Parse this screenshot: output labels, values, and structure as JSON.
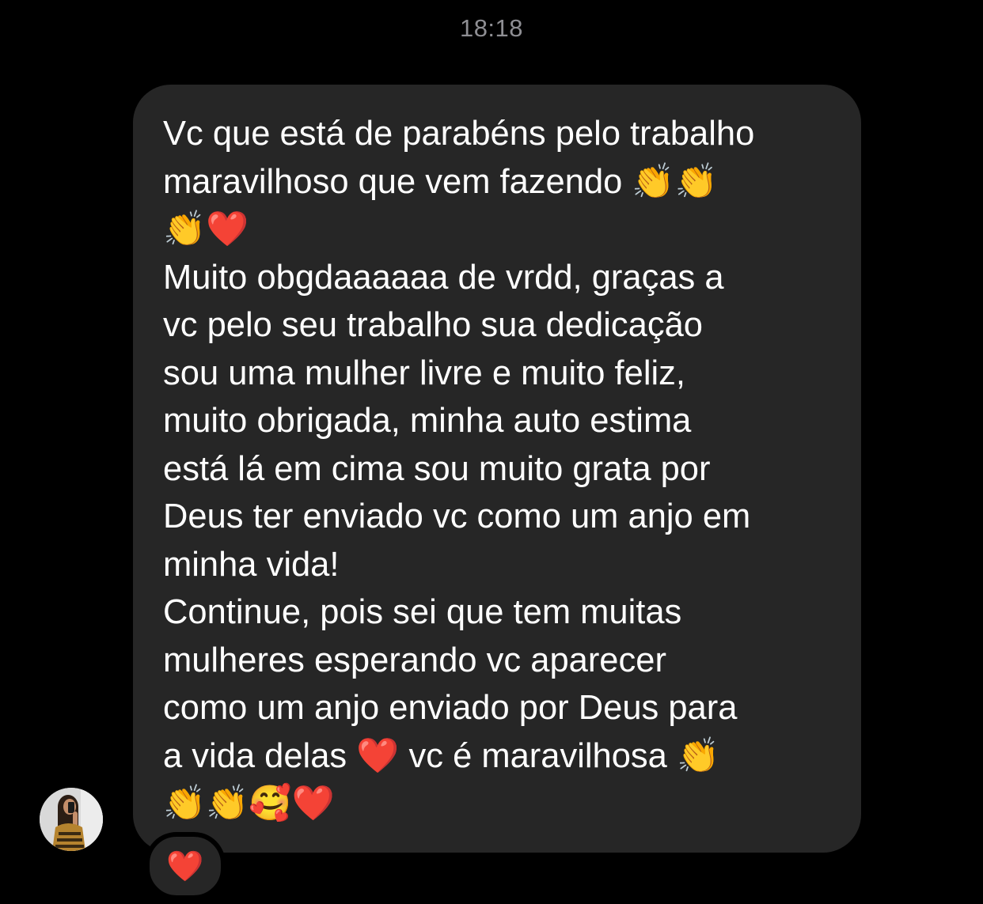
{
  "timestamp": "18:18",
  "message": {
    "text": "Vc que está de parabéns pelo trabalho\nmaravilhoso que vem fazendo 👏👏\n👏❤️\nMuito obgdaaaaaa de vrdd, graças a\nvc pelo seu trabalho sua dedicação\nsou uma mulher livre e muito feliz,\nmuito obrigada, minha auto estima\nestá lá em cima sou muito grata por\nDeus ter enviado vc como um anjo em\nminha vida!\nContinue, pois sei que tem muitas\nmulheres esperando vc aparecer\ncomo um anjo enviado por Deus para\na vida delas ❤️ vc é maravilhosa 👏\n👏👏🥰❤️"
  },
  "reaction": {
    "emoji": "❤️",
    "icon": "red-heart-icon"
  },
  "sender": {
    "avatar_icon": "profile-photo-avatar"
  },
  "colors": {
    "background": "#000000",
    "bubble": "#262626",
    "text": "#ffffff",
    "timestamp": "#8e8e93",
    "heart": "#e8142b"
  }
}
